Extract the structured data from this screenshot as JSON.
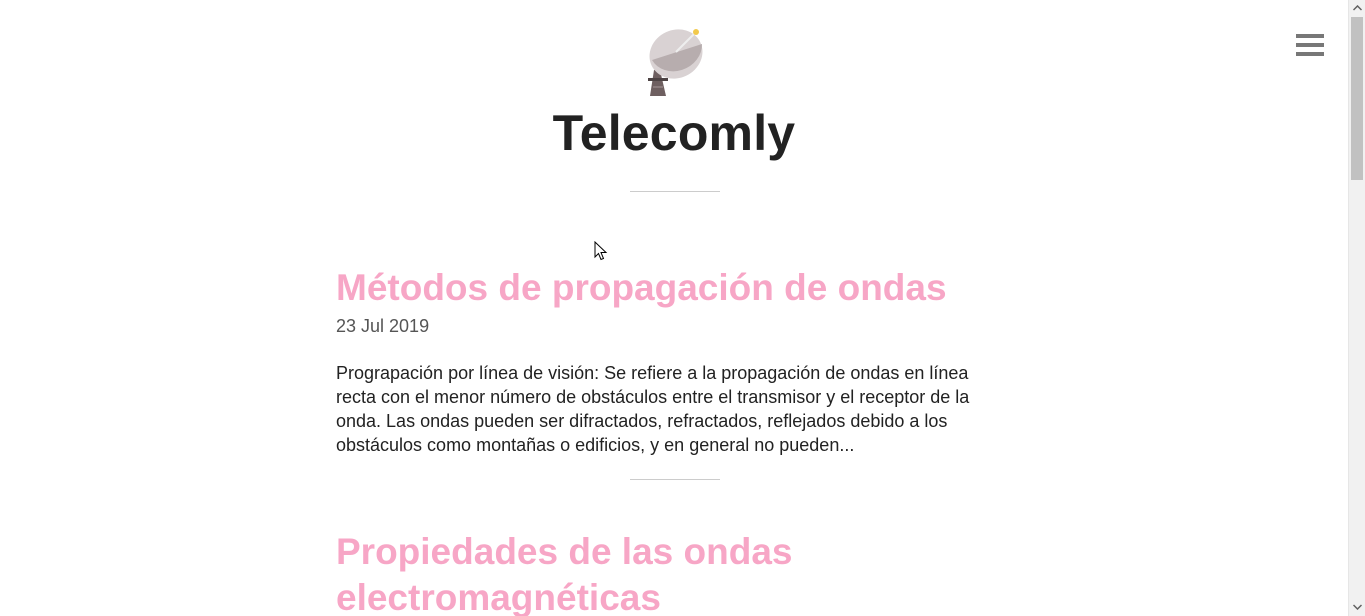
{
  "site": {
    "title": "Telecomly",
    "logo_icon": "satellite-dish-icon",
    "menu_icon": "hamburger-menu-icon"
  },
  "colors": {
    "post_title": "#f7a6c6",
    "site_title": "#222222",
    "text": "#222222",
    "date": "#555555",
    "divider": "#cccccc"
  },
  "posts": [
    {
      "title": "Métodos de propagación de ondas",
      "date": "23 Jul 2019",
      "excerpt_lines": [
        "Prograpación por línea de visión: Se refiere a la propagación de ondas en línea",
        "recta con el menor número de obstáculos entre el transmisor y el receptor de la",
        "onda. Las ondas pueden ser difractados, refractados, reflejados debido a los",
        "obstáculos como montañas o edificios, y en general no pueden..."
      ]
    },
    {
      "title_lines": [
        "Propiedades de las ondas",
        "electromagnéticas"
      ]
    }
  ],
  "scrollbar": {
    "up_icon": "arrow-up-icon",
    "down_icon": "arrow-down-icon"
  }
}
